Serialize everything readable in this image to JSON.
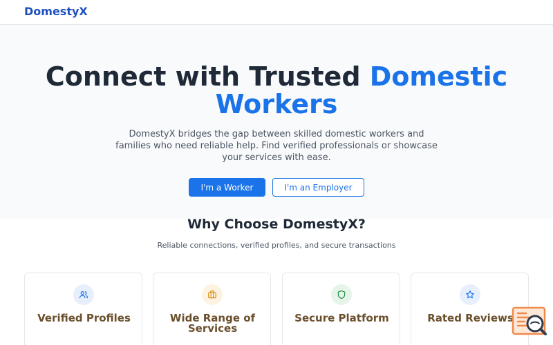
{
  "brand": "DomestyX",
  "hero": {
    "title_part1": "Connect with Trusted ",
    "title_part2": "Domestic Workers",
    "description": "DomestyX bridges the gap between skilled domestic workers and families who need reliable help. Find verified professionals or showcase your services with ease.",
    "primary_button": "I'm a Worker",
    "secondary_button": "I'm an Employer"
  },
  "features": {
    "title": "Why Choose DomestyX?",
    "subtitle": "Reliable connections, verified profiles, and secure transactions",
    "cards": [
      {
        "title": "Verified Profiles",
        "icon": "users-icon"
      },
      {
        "title": "Wide Range of Services",
        "icon": "briefcase-icon"
      },
      {
        "title": "Secure Platform",
        "icon": "shield-icon"
      },
      {
        "title": "Rated Reviews",
        "icon": "star-icon"
      }
    ]
  },
  "colors": {
    "brand": "#1e4fc2",
    "accent": "#1a73e8",
    "feature_title": "#6b4f2c",
    "chat_widget": "#f08a4b"
  }
}
